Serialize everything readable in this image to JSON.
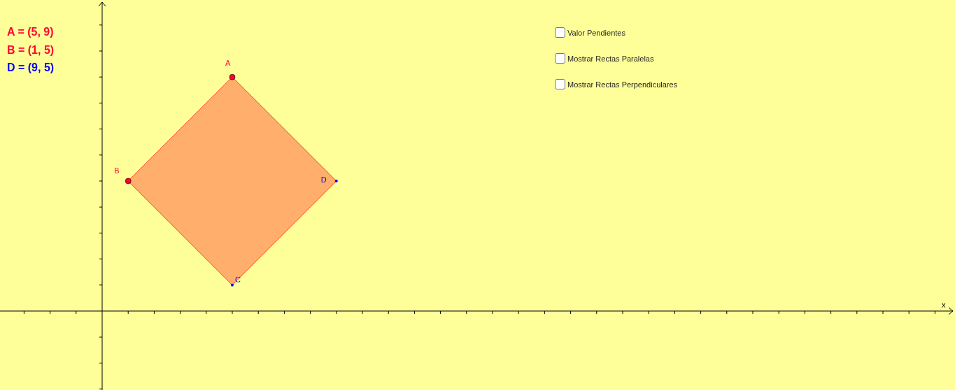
{
  "algebra": [
    {
      "text": "A = (5, 9)",
      "color": "#ff0033"
    },
    {
      "text": "B = (1, 5)",
      "color": "#ff0033"
    },
    {
      "text": "D = (9, 5)",
      "color": "#0000ff"
    }
  ],
  "checkboxes": [
    {
      "label": "Valor Pendientes",
      "checked": false
    },
    {
      "label": "Mostrar Rectas Paralelas",
      "checked": false
    },
    {
      "label": "Mostrar Rectas Perpendiculares",
      "checked": false
    }
  ],
  "axes": {
    "x_label": "x"
  },
  "points": [
    {
      "label": "A",
      "kind": "free",
      "color": "#ff0033"
    },
    {
      "label": "B",
      "kind": "free",
      "color": "#ff0033"
    },
    {
      "label": "C",
      "kind": "dependent",
      "color": "#0000ff"
    },
    {
      "label": "D",
      "kind": "dependent",
      "color": "#0000ff"
    }
  ]
}
